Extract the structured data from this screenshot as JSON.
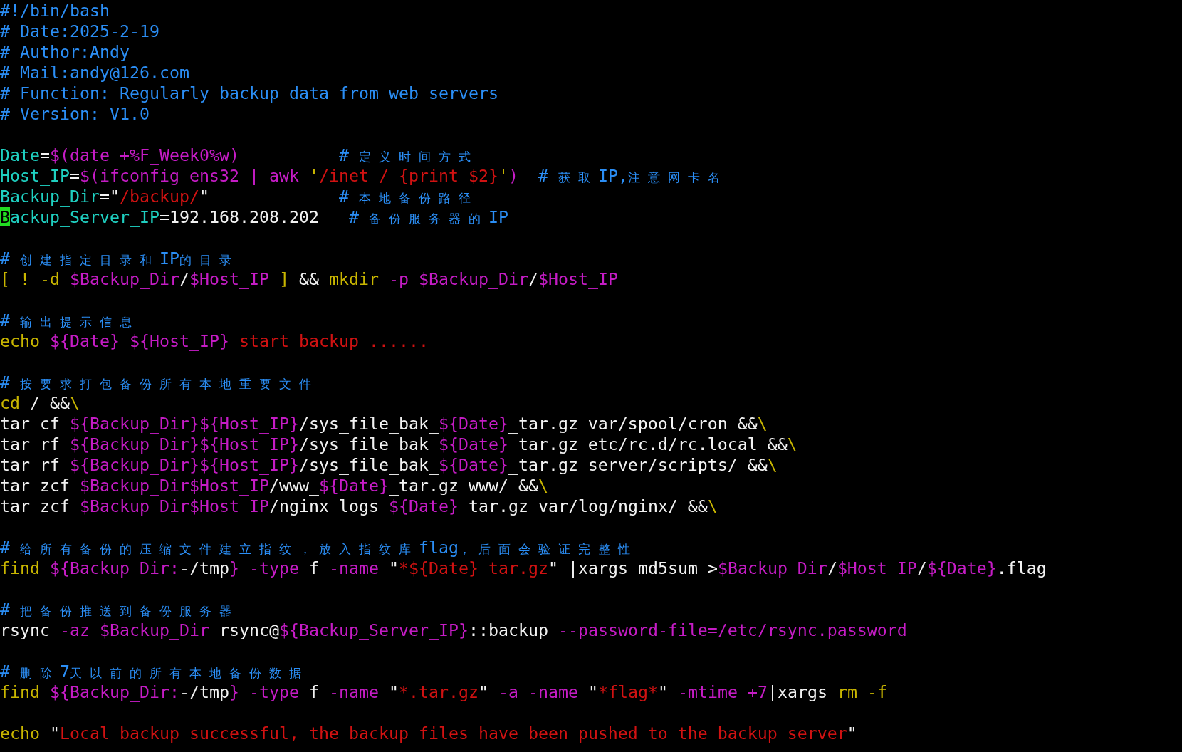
{
  "blocks": [
    {
      "lines": [
        {
          "tokens": [
            {
              "kind": "comment",
              "text": "#!/bin/bash"
            }
          ]
        },
        {
          "tokens": [
            {
              "kind": "comment",
              "text": "# Date:2025-2-19"
            }
          ]
        },
        {
          "tokens": [
            {
              "kind": "comment",
              "text": "# Author:Andy"
            }
          ]
        },
        {
          "tokens": [
            {
              "kind": "comment",
              "text": "# Mail:andy@126.com"
            }
          ]
        },
        {
          "tokens": [
            {
              "kind": "comment",
              "text": "# Function: Regularly backup data from web servers"
            }
          ]
        },
        {
          "tokens": [
            {
              "kind": "comment",
              "text": "# Version: V1.0"
            }
          ]
        }
      ]
    },
    {
      "lines": [
        {
          "tokens": [
            {
              "kind": "ident",
              "text": "Date"
            },
            {
              "kind": "plain",
              "text": "="
            },
            {
              "kind": "var",
              "text": "$(date +%F_Week0%w)          "
            },
            {
              "kind": "comment",
              "text": "# "
            },
            {
              "kind": "cjk",
              "text": "定义时间方式"
            }
          ]
        },
        {
          "tokens": [
            {
              "kind": "ident",
              "text": "Host_IP"
            },
            {
              "kind": "plain",
              "text": "="
            },
            {
              "kind": "var",
              "text": "$(ifconfig ens32 | awk "
            },
            {
              "kind": "keyword",
              "text": "'"
            },
            {
              "kind": "string",
              "text": "/inet / {print $2}"
            },
            {
              "kind": "keyword",
              "text": "'"
            },
            {
              "kind": "var",
              "text": ")  "
            },
            {
              "kind": "comment",
              "text": "# "
            },
            {
              "kind": "cjk",
              "text": "获取"
            },
            {
              "kind": "comment",
              "text": "IP,"
            },
            {
              "kind": "cjk",
              "text": "注意网卡名"
            }
          ]
        },
        {
          "tokens": [
            {
              "kind": "ident",
              "text": "Backup_Dir"
            },
            {
              "kind": "plain",
              "text": "=\""
            },
            {
              "kind": "string",
              "text": "/backup/"
            },
            {
              "kind": "plain",
              "text": "\"             "
            },
            {
              "kind": "comment",
              "text": "# "
            },
            {
              "kind": "cjk",
              "text": "本地备份路径"
            }
          ]
        },
        {
          "tokens": [
            {
              "kind": "cursor",
              "text": "B"
            },
            {
              "kind": "ident",
              "text": "ackup_Server_IP"
            },
            {
              "kind": "plain",
              "text": "=192.168.208.202   "
            },
            {
              "kind": "comment",
              "text": "# "
            },
            {
              "kind": "cjk",
              "text": "备份服务器的"
            },
            {
              "kind": "comment",
              "text": "IP"
            }
          ]
        }
      ]
    },
    {
      "lines": [
        {
          "tokens": [
            {
              "kind": "comment",
              "text": "# "
            },
            {
              "kind": "cjk",
              "text": "创建指定目录和"
            },
            {
              "kind": "comment",
              "text": "IP"
            },
            {
              "kind": "cjk",
              "text": "的目录"
            }
          ]
        },
        {
          "tokens": [
            {
              "kind": "keyword",
              "text": "[ ! -d "
            },
            {
              "kind": "var",
              "text": "$Backup_Dir"
            },
            {
              "kind": "plain",
              "text": "/"
            },
            {
              "kind": "var",
              "text": "$Host_IP"
            },
            {
              "kind": "keyword",
              "text": " ]"
            },
            {
              "kind": "plain",
              "text": " && "
            },
            {
              "kind": "keyword",
              "text": "mkdir"
            },
            {
              "kind": "var",
              "text": " -p $Backup_Dir"
            },
            {
              "kind": "plain",
              "text": "/"
            },
            {
              "kind": "var",
              "text": "$Host_IP"
            }
          ]
        }
      ]
    },
    {
      "lines": [
        {
          "tokens": [
            {
              "kind": "comment",
              "text": "# "
            },
            {
              "kind": "cjk",
              "text": "输出提示信息"
            }
          ]
        },
        {
          "tokens": [
            {
              "kind": "keyword",
              "text": "echo "
            },
            {
              "kind": "var",
              "text": "${Date} "
            },
            {
              "kind": "var",
              "text": "${Host_IP}"
            },
            {
              "kind": "string",
              "text": " start backup ......"
            }
          ]
        }
      ]
    },
    {
      "lines": [
        {
          "tokens": [
            {
              "kind": "comment",
              "text": "# "
            },
            {
              "kind": "cjk",
              "text": "按要求打包备份所有本地重要文件"
            }
          ]
        },
        {
          "tokens": [
            {
              "kind": "keyword",
              "text": "cd"
            },
            {
              "kind": "plain",
              "text": " / &&"
            },
            {
              "kind": "keyword",
              "text": "\\"
            }
          ]
        },
        {
          "tokens": [
            {
              "kind": "plain",
              "text": "tar cf "
            },
            {
              "kind": "var",
              "text": "${Backup_Dir}${Host_IP}"
            },
            {
              "kind": "plain",
              "text": "/sys_file_bak_"
            },
            {
              "kind": "var",
              "text": "${Date}"
            },
            {
              "kind": "plain",
              "text": "_tar.gz var/spool/cron &&"
            },
            {
              "kind": "keyword",
              "text": "\\"
            }
          ]
        },
        {
          "tokens": [
            {
              "kind": "plain",
              "text": "tar rf "
            },
            {
              "kind": "var",
              "text": "${Backup_Dir}${Host_IP}"
            },
            {
              "kind": "plain",
              "text": "/sys_file_bak_"
            },
            {
              "kind": "var",
              "text": "${Date}"
            },
            {
              "kind": "plain",
              "text": "_tar.gz etc/rc.d/rc.local &&"
            },
            {
              "kind": "keyword",
              "text": "\\"
            }
          ]
        },
        {
          "tokens": [
            {
              "kind": "plain",
              "text": "tar rf "
            },
            {
              "kind": "var",
              "text": "${Backup_Dir}${Host_IP}"
            },
            {
              "kind": "plain",
              "text": "/sys_file_bak_"
            },
            {
              "kind": "var",
              "text": "${Date}"
            },
            {
              "kind": "plain",
              "text": "_tar.gz server/scripts/ &&"
            },
            {
              "kind": "keyword",
              "text": "\\"
            }
          ]
        },
        {
          "tokens": [
            {
              "kind": "plain",
              "text": "tar zcf "
            },
            {
              "kind": "var",
              "text": "$Backup_Dir$Host_IP"
            },
            {
              "kind": "plain",
              "text": "/www_"
            },
            {
              "kind": "var",
              "text": "${Date}"
            },
            {
              "kind": "plain",
              "text": "_tar.gz www/ &&"
            },
            {
              "kind": "keyword",
              "text": "\\"
            }
          ]
        },
        {
          "tokens": [
            {
              "kind": "plain",
              "text": "tar zcf "
            },
            {
              "kind": "var",
              "text": "$Backup_Dir$Host_IP"
            },
            {
              "kind": "plain",
              "text": "/nginx_logs_"
            },
            {
              "kind": "var",
              "text": "${Date}"
            },
            {
              "kind": "plain",
              "text": "_tar.gz var/log/nginx/ &&"
            },
            {
              "kind": "keyword",
              "text": "\\"
            }
          ]
        }
      ]
    },
    {
      "lines": [
        {
          "tokens": [
            {
              "kind": "comment",
              "text": "# "
            },
            {
              "kind": "cjk",
              "text": "给所有备份的压缩文件建立指纹，放入指纹库"
            },
            {
              "kind": "comment",
              "text": "flag"
            },
            {
              "kind": "cjk",
              "text": "，后面会验证完整性"
            }
          ]
        },
        {
          "tokens": [
            {
              "kind": "keyword",
              "text": "find "
            },
            {
              "kind": "var",
              "text": "${Backup_Dir:"
            },
            {
              "kind": "plain",
              "text": "-/tmp"
            },
            {
              "kind": "var",
              "text": "} -type "
            },
            {
              "kind": "plain",
              "text": "f"
            },
            {
              "kind": "var",
              "text": " -name "
            },
            {
              "kind": "plain",
              "text": "\""
            },
            {
              "kind": "string",
              "text": "*${Date}_tar.gz"
            },
            {
              "kind": "plain",
              "text": "\" |xargs md5sum >"
            },
            {
              "kind": "var",
              "text": "$Backup_Dir"
            },
            {
              "kind": "plain",
              "text": "/"
            },
            {
              "kind": "var",
              "text": "$Host_IP"
            },
            {
              "kind": "plain",
              "text": "/"
            },
            {
              "kind": "var",
              "text": "${Date}"
            },
            {
              "kind": "plain",
              "text": ".flag"
            }
          ]
        }
      ]
    },
    {
      "lines": [
        {
          "tokens": [
            {
              "kind": "comment",
              "text": "# "
            },
            {
              "kind": "cjk",
              "text": "把备份推送到备份服务器"
            }
          ]
        },
        {
          "tokens": [
            {
              "kind": "plain",
              "text": "rsync"
            },
            {
              "kind": "var",
              "text": " -az $Backup_Dir"
            },
            {
              "kind": "plain",
              "text": " rsync@"
            },
            {
              "kind": "var",
              "text": "${Backup_Server_IP}"
            },
            {
              "kind": "plain",
              "text": "::backup "
            },
            {
              "kind": "var",
              "text": "--password-file=/etc/rsync.password"
            }
          ]
        }
      ]
    },
    {
      "lines": [
        {
          "tokens": [
            {
              "kind": "comment",
              "text": "# "
            },
            {
              "kind": "cjk",
              "text": "删除"
            },
            {
              "kind": "comment",
              "text": "7"
            },
            {
              "kind": "cjk",
              "text": "天以前的所有本地备份数据"
            }
          ]
        },
        {
          "tokens": [
            {
              "kind": "keyword",
              "text": "find "
            },
            {
              "kind": "var",
              "text": "${Backup_Dir:"
            },
            {
              "kind": "plain",
              "text": "-/tmp"
            },
            {
              "kind": "var",
              "text": "} -type "
            },
            {
              "kind": "plain",
              "text": "f"
            },
            {
              "kind": "var",
              "text": " -name "
            },
            {
              "kind": "plain",
              "text": "\""
            },
            {
              "kind": "string",
              "text": "*.tar.gz"
            },
            {
              "kind": "plain",
              "text": "\""
            },
            {
              "kind": "var",
              "text": " -a -name "
            },
            {
              "kind": "plain",
              "text": "\""
            },
            {
              "kind": "string",
              "text": "*flag*"
            },
            {
              "kind": "plain",
              "text": "\""
            },
            {
              "kind": "var",
              "text": " -mtime +7"
            },
            {
              "kind": "plain",
              "text": "|xargs "
            },
            {
              "kind": "keyword",
              "text": "rm -f"
            }
          ]
        }
      ]
    },
    {
      "lines": [
        {
          "tokens": [
            {
              "kind": "keyword",
              "text": "echo"
            },
            {
              "kind": "plain",
              "text": " \""
            },
            {
              "kind": "string",
              "text": "Local backup successful, the backup files have been pushed to the backup server"
            },
            {
              "kind": "plain",
              "text": "\""
            }
          ]
        }
      ]
    }
  ]
}
